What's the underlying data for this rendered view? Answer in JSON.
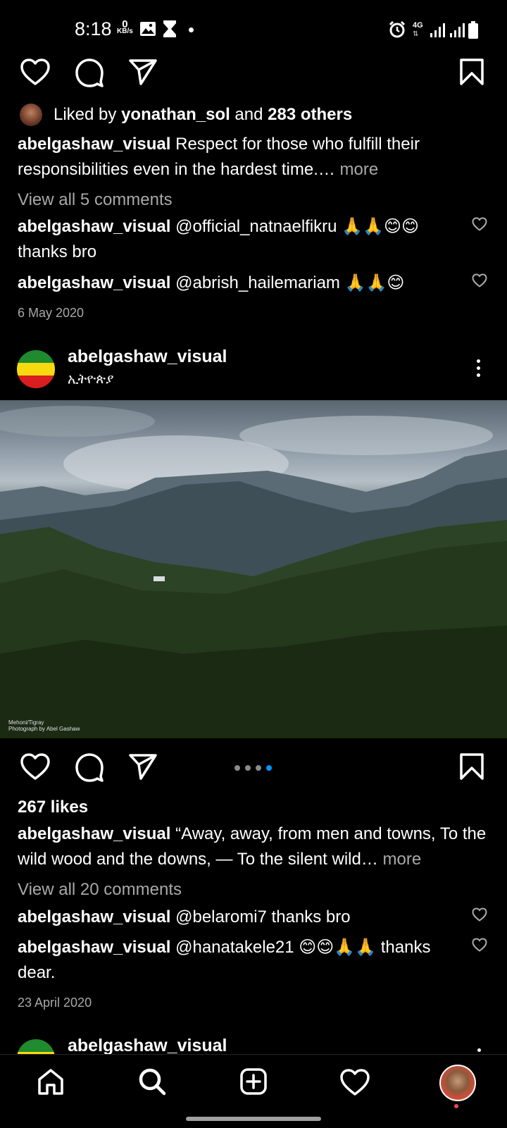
{
  "status_bar": {
    "time": "8:18",
    "net_speed_value": "0",
    "net_speed_unit": "KB/s",
    "network": "4G"
  },
  "post1": {
    "liked_by_prefix": "Liked by ",
    "liked_by_user": "yonathan_sol",
    "liked_by_mid": " and ",
    "liked_by_others": "283 others",
    "caption_user": "abelgashaw_visual",
    "caption_text": " Respect for those who fulfill their responsibilities even in the hardest time.…",
    "more": " more",
    "view_comments": "View all 5 comments",
    "comments": [
      {
        "user": "abelgashaw_visual",
        "text": " @official_natnaelfikru 🙏🙏😊😊 thanks bro"
      },
      {
        "user": "abelgashaw_visual",
        "text": " @abrish_hailemariam 🙏🙏😊"
      }
    ],
    "date": "6 May 2020"
  },
  "post2": {
    "username": "abelgashaw_visual",
    "location": "ኢትዮጵያ",
    "photo_credit_line1": "Mehoni/Tigray",
    "photo_credit_line2": "Photograph by Abel Gashaw",
    "likes": "267 likes",
    "caption_user": "abelgashaw_visual",
    "caption_text": " “Away, away, from men and towns,  To the wild wood and the downs, —  To the silent wild…",
    "more": " more",
    "view_comments": "View all 20 comments",
    "comments": [
      {
        "user": "abelgashaw_visual",
        "text": " @belaromi7 thanks bro"
      },
      {
        "user": "abelgashaw_visual",
        "text": " @hanatakele21 😊😊🙏🙏 thanks dear."
      }
    ],
    "date": "23 April 2020",
    "carousel_count": 4,
    "carousel_active": 4
  },
  "post3": {
    "username": "abelgashaw_visual"
  },
  "colors": {
    "accent": "#0095f6",
    "notification_dot": "#ed4956",
    "secondary_text": "#a8a8a8"
  }
}
